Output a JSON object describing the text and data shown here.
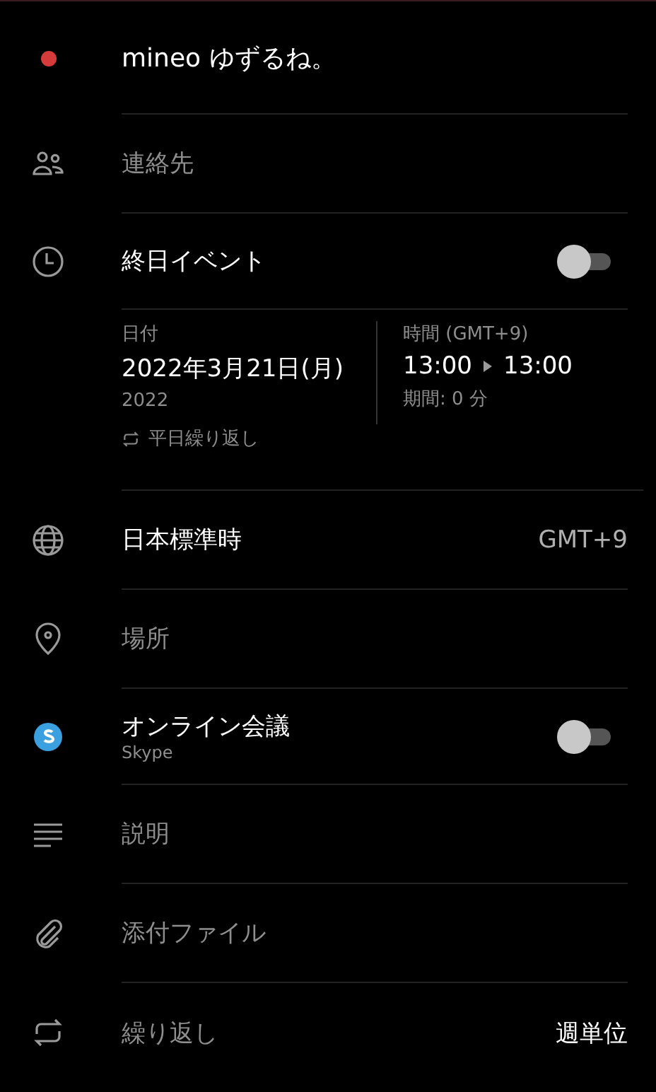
{
  "rows": [
    {
      "kind": "title",
      "text": "mineo ゆずるね。",
      "color": "#d63b3b"
    },
    {
      "kind": "field",
      "placeholder": "連絡先"
    },
    {
      "kind": "toggle",
      "label": "終日イベント",
      "on": false
    },
    {
      "kind": "datetime",
      "date_label": "日付",
      "date": "2022年3月21日(月)",
      "year": "2022",
      "repeat_note": "平日繰り返し",
      "time_label": "時間 (GMT+9)",
      "start": "13:00",
      "end": "13:00",
      "duration": "期間: 0 分"
    },
    {
      "kind": "value",
      "label": "日本標準時",
      "dimmed": false,
      "value": "GMT+9"
    },
    {
      "kind": "field",
      "placeholder": "場所"
    },
    {
      "kind": "toggle",
      "label": "オンライン会議",
      "sublabel": "Skype",
      "on": false
    },
    {
      "kind": "field",
      "placeholder": "説明"
    },
    {
      "kind": "field",
      "placeholder": "添付ファイル"
    },
    {
      "kind": "value",
      "label": "繰り返し",
      "dimmed": true,
      "value": "週単位"
    }
  ]
}
